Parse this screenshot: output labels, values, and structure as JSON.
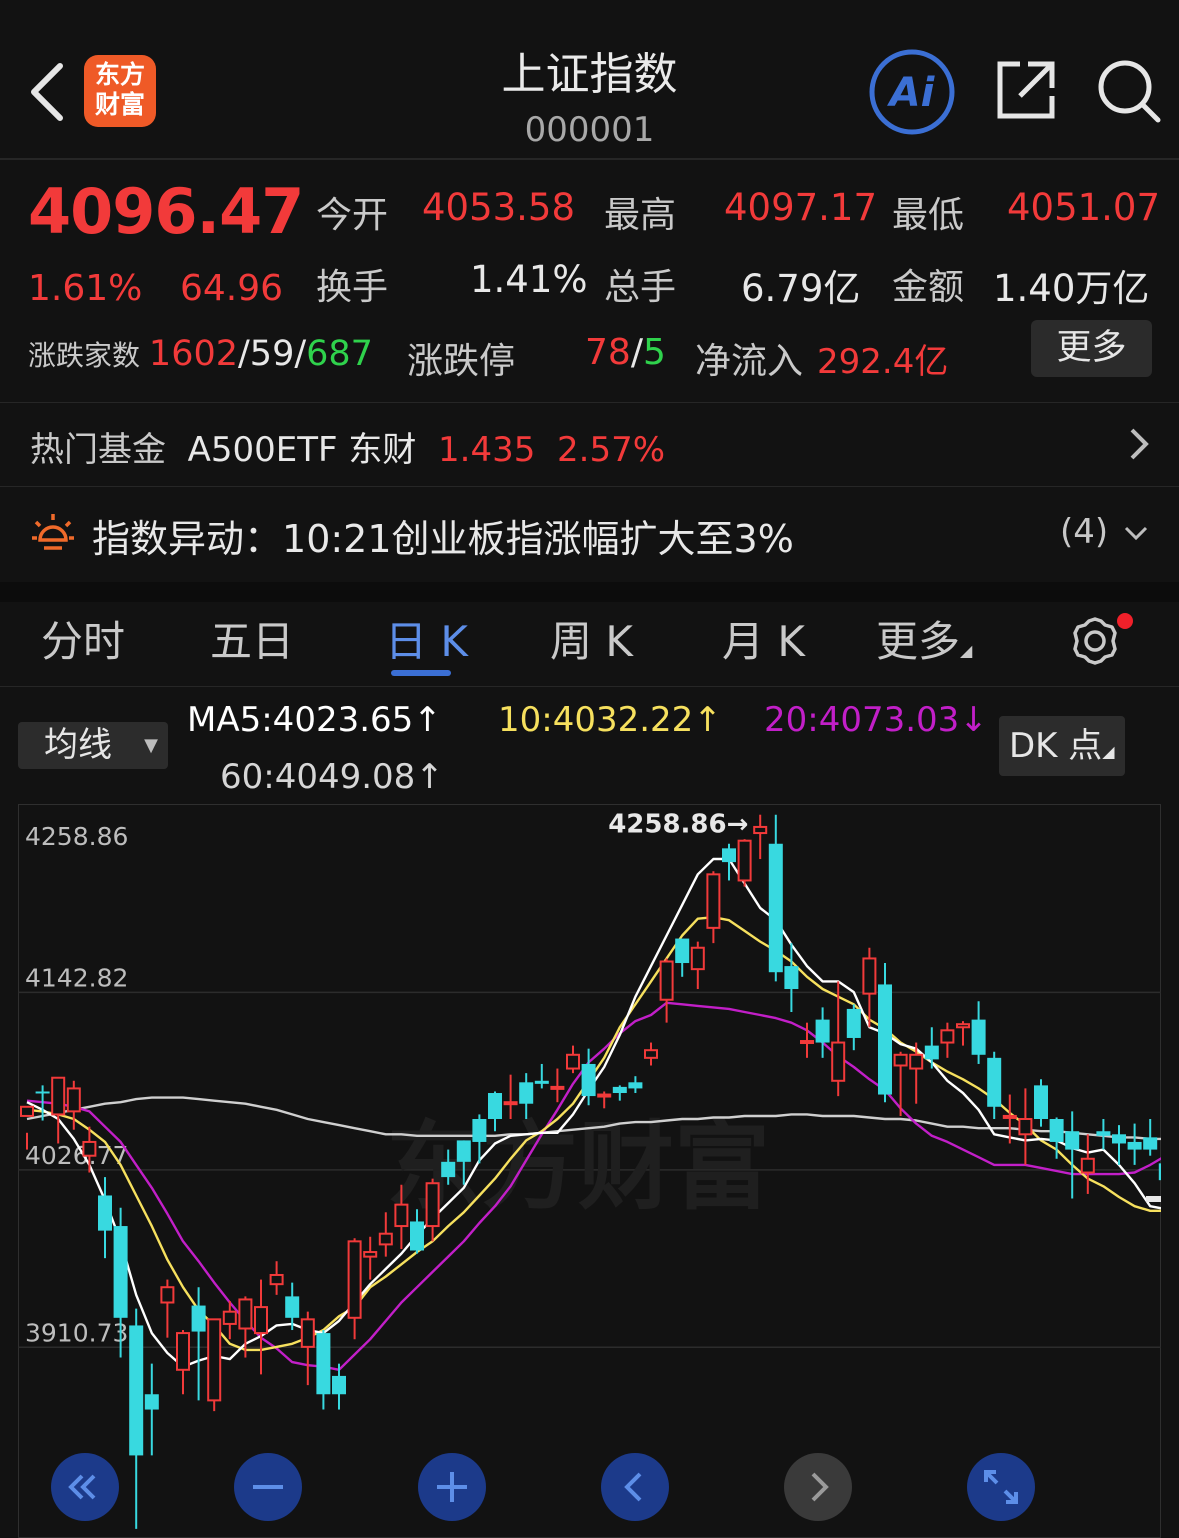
{
  "header": {
    "logo_line1": "东方",
    "logo_line2": "财富",
    "title": "上证指数",
    "code": "000001",
    "ai_label": "Ai"
  },
  "quote": {
    "price": "4096.47",
    "change_pct": "1.61%",
    "change": "64.96",
    "open_label": "今开",
    "open": "4053.58",
    "high_label": "最高",
    "high": "4097.17",
    "low_label": "最低",
    "low": "4051.07",
    "turnover_label": "换手",
    "turnover": "1.41%",
    "volume_label": "总手",
    "volume": "6.79亿",
    "amount_label": "金额",
    "amount": "1.40万亿",
    "breadth_label": "涨跌家数",
    "up": "1602",
    "flat": "59",
    "down": "687",
    "limit_label": "涨跌停",
    "limit_up": "78",
    "limit_down": "5",
    "netflow_label": "净流入",
    "netflow": "292.4亿",
    "more_label": "更多"
  },
  "fund": {
    "label": "热门基金",
    "name": "A500ETF 东财",
    "price": "1.435",
    "pct": "2.57%"
  },
  "alert": {
    "label": "指数异动：",
    "text": "10:21创业板指涨幅扩大至3%",
    "count": "(4)"
  },
  "tabs": [
    "分时",
    "五日",
    "日 K",
    "周 K",
    "月 K",
    "更多"
  ],
  "active_tab": "日 K",
  "ma": {
    "select_label": "均线",
    "ma5": "MA5:4023.65↑",
    "ma10": "10:4032.22↑",
    "ma20": "20:4073.03↓",
    "ma60": "60:4049.08↑",
    "dk_label": "DK 点"
  },
  "colors": {
    "up": "#f23a3a",
    "down": "#2fd24c",
    "candle_down": "#38d9e0",
    "ma5": "#ffffff",
    "ma10": "#f6e05e",
    "ma20": "#c21fc8",
    "ma60": "#cfcfcf",
    "accent": "#3b6fd4"
  },
  "watermark": "东方财富",
  "chart_data": {
    "type": "candlestick",
    "y_ticks": [
      "4258.86",
      "4142.82",
      "4026.77",
      "3910.73"
    ],
    "max_marker": "4258.86→",
    "ylim": [
      3786,
      4266
    ],
    "candles": [
      [
        4062,
        4068,
        4051,
        4040
      ],
      [
        4078,
        4077,
        4082,
        4059
      ],
      [
        4063,
        4087,
        4064,
        4044
      ],
      [
        4065,
        4080,
        4085,
        4053
      ],
      [
        4036,
        4045,
        4055,
        4025
      ],
      [
        4010,
        3987,
        4022,
        3969
      ],
      [
        3990,
        3930,
        4002,
        3904
      ],
      [
        3925,
        3840,
        3936,
        3792
      ],
      [
        3880,
        3870,
        3900,
        3840
      ],
      [
        3940,
        3950,
        3955,
        3917
      ],
      [
        3896,
        3920,
        3922,
        3880
      ],
      [
        3938,
        3921,
        3950,
        3876
      ],
      [
        3876,
        3929,
        3924,
        3869
      ],
      [
        3926,
        3934,
        3941,
        3916
      ],
      [
        3923,
        3942,
        3944,
        3904
      ],
      [
        3920,
        3937,
        3955,
        3893
      ],
      [
        3952,
        3958,
        3967,
        3945
      ],
      [
        3944,
        3930,
        3953,
        3922
      ],
      [
        3911,
        3929,
        3934,
        3886
      ],
      [
        3920,
        3880,
        3922,
        3870
      ],
      [
        3892,
        3880,
        3900,
        3870
      ],
      [
        3930,
        3980,
        3982,
        3916
      ],
      [
        3970,
        3973,
        3983,
        3955
      ],
      [
        3978,
        3985,
        3999,
        3970
      ],
      [
        3990,
        4004,
        4017,
        3975
      ],
      [
        3993,
        3974,
        4001,
        3972
      ],
      [
        3990,
        4018,
        4021,
        3980
      ],
      [
        4032,
        4022,
        4040,
        4017
      ],
      [
        4046,
        4032,
        4046,
        4017
      ],
      [
        4060,
        4045,
        4063,
        4031
      ],
      [
        4077,
        4060,
        4078,
        4052
      ],
      [
        4070,
        4071,
        4089,
        4060
      ],
      [
        4084,
        4070,
        4090,
        4060
      ],
      [
        4085,
        4083,
        4096,
        4080
      ],
      [
        4080,
        4081,
        4093,
        4071
      ],
      [
        4093,
        4102,
        4108,
        4090
      ],
      [
        4096,
        4075,
        4106,
        4069
      ],
      [
        4075,
        4076,
        4078,
        4067
      ],
      [
        4081,
        4077,
        4082,
        4072
      ],
      [
        4084,
        4080,
        4088,
        4077
      ],
      [
        4100,
        4105,
        4110,
        4095
      ],
      [
        4138,
        4163,
        4165,
        4123
      ],
      [
        4178,
        4162,
        4170,
        4153
      ],
      [
        4158,
        4172,
        4176,
        4145
      ],
      [
        4185,
        4220,
        4222,
        4175
      ],
      [
        4237,
        4228,
        4240,
        4216
      ],
      [
        4216,
        4242,
        4243,
        4212
      ],
      [
        4247,
        4251,
        4259,
        4230
      ],
      [
        4240,
        4156,
        4259,
        4150
      ],
      [
        4160,
        4145,
        4175,
        4130
      ],
      [
        4110,
        4111,
        4123,
        4100
      ],
      [
        4125,
        4110,
        4133,
        4100
      ],
      [
        4085,
        4110,
        4150,
        4075
      ],
      [
        4132,
        4113,
        4135,
        4105
      ],
      [
        4142,
        4165,
        4172,
        4120
      ],
      [
        4148,
        4076,
        4162,
        4071
      ],
      [
        4095,
        4102,
        4104,
        4062
      ],
      [
        4093,
        4102,
        4110,
        4070
      ],
      [
        4108,
        4099,
        4120,
        4093
      ],
      [
        4110,
        4118,
        4123,
        4100
      ],
      [
        4120,
        4122,
        4124,
        4108
      ],
      [
        4125,
        4102,
        4137,
        4096
      ],
      [
        4100,
        4068,
        4104,
        4060
      ],
      [
        4062,
        4062,
        4076,
        4044
      ],
      [
        4050,
        4060,
        4080,
        4030
      ],
      [
        4082,
        4060,
        4086,
        4055
      ],
      [
        4060,
        4045,
        4061,
        4034
      ],
      [
        4052,
        4040,
        4065,
        4008
      ],
      [
        4025,
        4034,
        4050,
        4011
      ],
      [
        4052,
        4049,
        4060,
        4040
      ],
      [
        4050,
        4044,
        4056,
        4030
      ],
      [
        4045,
        4040,
        4057,
        4030
      ],
      [
        4048,
        4040,
        4060,
        4036
      ],
      [
        4031,
        4020,
        4040,
        4008
      ],
      [
        3953,
        3938,
        3960,
        3911
      ],
      [
        3997,
        3968,
        4011,
        3931
      ],
      [
        3960,
        3979,
        3990,
        3955
      ],
      [
        3968,
        3977,
        4020,
        3946
      ],
      [
        3998,
        4001,
        4024,
        3982
      ],
      [
        4032,
        4045,
        4068,
        4015
      ]
    ],
    "ma5": [
      4071,
      4066,
      4060,
      4047,
      4030,
      4007,
      3980,
      3945,
      3920,
      3907,
      3898,
      3902,
      3905,
      3903,
      3913,
      3918,
      3925,
      3926,
      3922,
      3920,
      3928,
      3940,
      3952,
      3962,
      3972,
      3984,
      3995,
      4005,
      4015,
      4033,
      4044,
      4049,
      4050,
      4051,
      4051,
      4063,
      4079,
      4094,
      4115,
      4140,
      4160,
      4180,
      4200,
      4220,
      4230,
      4230,
      4214,
      4198,
      4190,
      4174,
      4160,
      4150,
      4150,
      4143,
      4120,
      4116,
      4109,
      4106,
      4097,
      4085,
      4077,
      4066,
      4050,
      4048,
      4046,
      4047,
      4046,
      4041,
      4038,
      4040,
      4030,
      4018,
      4003,
      4001,
      3991,
      3985,
      3967,
      3985,
      3995,
      4023
    ],
    "ma10": [
      4066,
      4065,
      4063,
      4060,
      4053,
      4045,
      4030,
      4010,
      3990,
      3968,
      3950,
      3935,
      3925,
      3913,
      3909,
      3909,
      3911,
      3913,
      3917,
      3922,
      3931,
      3937,
      3950,
      3957,
      3965,
      3973,
      3980,
      3990,
      3999,
      4010,
      4021,
      4034,
      4046,
      4052,
      4060,
      4070,
      4085,
      4100,
      4120,
      4135,
      4150,
      4165,
      4180,
      4191,
      4192,
      4190,
      4183,
      4176,
      4170,
      4163,
      4153,
      4145,
      4140,
      4135,
      4125,
      4119,
      4110,
      4104,
      4097,
      4091,
      4086,
      4080,
      4073,
      4064,
      4056,
      4046,
      4040,
      4030,
      4021,
      4016,
      4009,
      4003,
      4000,
      4000,
      4003,
      4008,
      4012,
      4021,
      4032,
      4040
    ],
    "ma20": [
      4072,
      4071,
      4070,
      4068,
      4065,
      4055,
      4045,
      4030,
      4015,
      3998,
      3980,
      3967,
      3953,
      3940,
      3928,
      3917,
      3910,
      3901,
      3899,
      3898,
      3896,
      3906,
      3916,
      3928,
      3940,
      3950,
      3960,
      3970,
      3980,
      3992,
      4003,
      4016,
      4033,
      4050,
      4066,
      4083,
      4097,
      4106,
      4116,
      4124,
      4128,
      4136,
      4135,
      4134,
      4133,
      4132,
      4130,
      4128,
      4126,
      4123,
      4118,
      4110,
      4101,
      4094,
      4086,
      4079,
      4067,
      4057,
      4049,
      4045,
      4040,
      4035,
      4030,
      4030,
      4030,
      4028,
      4026,
      4024,
      4024,
      4024,
      4024,
      4025,
      4030,
      4036,
      4046,
      4053,
      4062,
      4073,
      4073,
      4073
    ],
    "ma60": [
      4060,
      4062,
      4064,
      4066,
      4068,
      4070,
      4071,
      4073,
      4074,
      4074,
      4074,
      4073,
      4072,
      4071,
      4070,
      4068,
      4066,
      4063,
      4060,
      4058,
      4056,
      4054,
      4052,
      4050,
      4050,
      4049,
      4049,
      4049,
      4049,
      4049,
      4049,
      4050,
      4050,
      4051,
      4052,
      4053,
      4054,
      4055,
      4057,
      4058,
      4058,
      4059,
      4060,
      4060,
      4061,
      4061,
      4062,
      4062,
      4062,
      4063,
      4063,
      4062,
      4062,
      4062,
      4061,
      4060,
      4060,
      4059,
      4057,
      4055,
      4055,
      4054,
      4054,
      4054,
      4053,
      4052,
      4052,
      4051,
      4050,
      4049,
      4048,
      4048,
      4047,
      4047,
      4046,
      4046,
      4046,
      4047,
      4048,
      4049
    ]
  }
}
